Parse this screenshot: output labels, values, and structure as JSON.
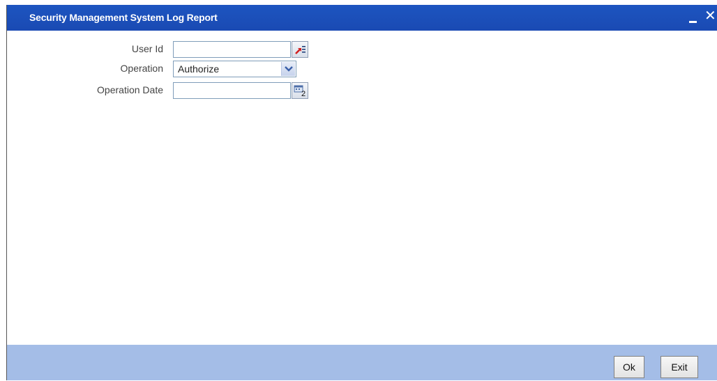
{
  "window": {
    "title": "Security Management System Log Report",
    "minimize_label": "",
    "close_label": "✕"
  },
  "form": {
    "user_id": {
      "label": "User Id",
      "value": ""
    },
    "operation": {
      "label": "Operation",
      "selected": "Authorize"
    },
    "operation_date": {
      "label": "Operation Date",
      "value": ""
    }
  },
  "footer": {
    "ok_label": "Ok",
    "exit_label": "Exit"
  },
  "colors": {
    "titlebar": "#1d55c0",
    "footer": "#a4bde7"
  }
}
